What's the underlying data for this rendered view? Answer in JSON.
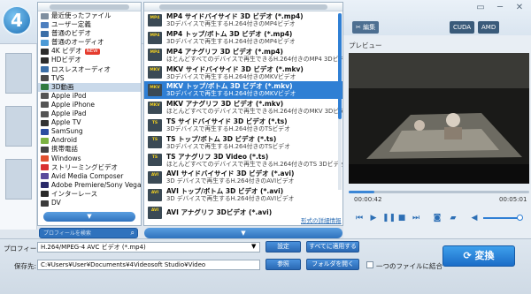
{
  "app": {
    "logo": "4"
  },
  "topbar": {
    "edit_label": "編集",
    "cuda_label": "CUDA",
    "amd_label": "AMD"
  },
  "preview": {
    "label": "プレビュー",
    "time_current": "00:00:42",
    "time_total": "00:05:01",
    "progress": 0.14
  },
  "categories": [
    {
      "label": "最近使ったファイル",
      "icon_color": "#7f8fa0"
    },
    {
      "label": "ユーザー定義",
      "icon_color": "#4d7fbf"
    },
    {
      "label": "普通のビデオ",
      "icon_color": "#3b6fa8"
    },
    {
      "label": "普通のオーディオ",
      "icon_color": "#4c9ad6"
    },
    {
      "label": "4K ビデオ",
      "icon_color": "#2d2d2d",
      "badge": "NEW"
    },
    {
      "label": "HDビデオ",
      "icon_color": "#2d2d2d"
    },
    {
      "label": "ロスレスオーディオ",
      "icon_color": "#3b6fa8"
    },
    {
      "label": "TVS",
      "icon_color": "#4a4a4a"
    },
    {
      "label": "3D動画",
      "icon_color": "#2f7a3f",
      "selected": true
    },
    {
      "label": "Apple iPod",
      "icon_color": "#555"
    },
    {
      "label": "Apple iPhone",
      "icon_color": "#555"
    },
    {
      "label": "Apple iPad",
      "icon_color": "#555"
    },
    {
      "label": "Apple TV",
      "icon_color": "#333"
    },
    {
      "label": "SamSung",
      "icon_color": "#2b4da0"
    },
    {
      "label": "Android",
      "icon_color": "#7cb342"
    },
    {
      "label": "携帯電話",
      "icon_color": "#444"
    },
    {
      "label": "Windows",
      "icon_color": "#e0502f"
    },
    {
      "label": "ストリーミングビデオ",
      "icon_color": "#d93030"
    },
    {
      "label": "Avid Media Composer",
      "icon_color": "#5b4a9c"
    },
    {
      "label": "Adobe Premiere/Sony Vegas",
      "icon_color": "#2a2a6a"
    },
    {
      "label": "インターレース",
      "icon_color": "#2a2a2a"
    },
    {
      "label": "DV",
      "icon_color": "#3a3a3a"
    }
  ],
  "formats": [
    {
      "icon": "MP4",
      "name": "MP4 サイドバイサイド 3D ビデオ (*.mp4)",
      "desc": "3Dデバイスで再生するH.264付きのMP4ビデオ"
    },
    {
      "icon": "MP4",
      "name": "MP4 トップ/ボトム 3D ビデオ (*.mp4)",
      "desc": "3Dデバイスで再生するH.264付きのMP4ビデオ"
    },
    {
      "icon": "MP4",
      "name": "MP4 アナグリフ 3D ビデオ (*.mp4)",
      "desc": "ほとんどすべてのデバイスで再生できるH.264付きのMP4 3Dビデオ"
    },
    {
      "icon": "MKV",
      "name": "MKV サイドバイサイド 3D ビデオ (*.mkv)",
      "desc": "3Dデバイスで再生するH.264付きのMKVビデオ"
    },
    {
      "icon": "MKV",
      "name": "MKV トップ/ボトム 3D ビデオ (*.mkv)",
      "desc": "3Dデバイスで再生するH.264付きのMKVビデオ",
      "selected": true
    },
    {
      "icon": "MKV",
      "name": "MKV アナグリフ 3D ビデオ (*.mkv)",
      "desc": "ほとんどすべてのデバイスで再生できるH.264付きのMKV 3Dビデオ"
    },
    {
      "icon": "TS",
      "name": "TS サイドバイサイド 3D ビデオ (*.ts)",
      "desc": "3Dデバイスで再生するH.264付きのTSビデオ"
    },
    {
      "icon": "TS",
      "name": "TS トップ/ボトム 3D ビデオ (*.ts)",
      "desc": "3Dデバイスで再生するH.264付きのTSビデオ"
    },
    {
      "icon": "TS",
      "name": "TS アナグリフ 3D Video (*.ts)",
      "desc": "ほとんどすべてのデバイスで再生できるH.264付きのTS 3Dビデオ"
    },
    {
      "icon": "AVI",
      "name": "AVI サイドバイサイド 3D ビデオ (*.avi)",
      "desc": "3D デバイスで再生するH.264付きのAVIビデオ"
    },
    {
      "icon": "AVI",
      "name": "AVI トップ/ボトム 3D ビデオ (*.avi)",
      "desc": "3D デバイスで再生するH.264付きのAVIビデオ"
    },
    {
      "icon": "AVI",
      "name": "AVI アナグリフ 3Dビデオ (*.avi)",
      "desc": ""
    }
  ],
  "search": {
    "placeholder": "プロフィールを検索",
    "icon": "search-icon"
  },
  "format_settings_link": "形式の詳細情報",
  "bottom": {
    "profile_label": "プロフィール:",
    "profile_value": "H.264/MPEG-4 AVC ビデオ (*.mp4)",
    "settings_button": "設定",
    "apply_all_button": "すべてに適用する",
    "dest_label": "保存先:",
    "dest_value": "C:¥Users¥User¥Documents¥4Videosoft Studio¥Video",
    "browse_button": "参照",
    "open_folder_button": "フォルダを開く",
    "merge_label": "一つのファイルに結合",
    "convert_button": "変換"
  }
}
